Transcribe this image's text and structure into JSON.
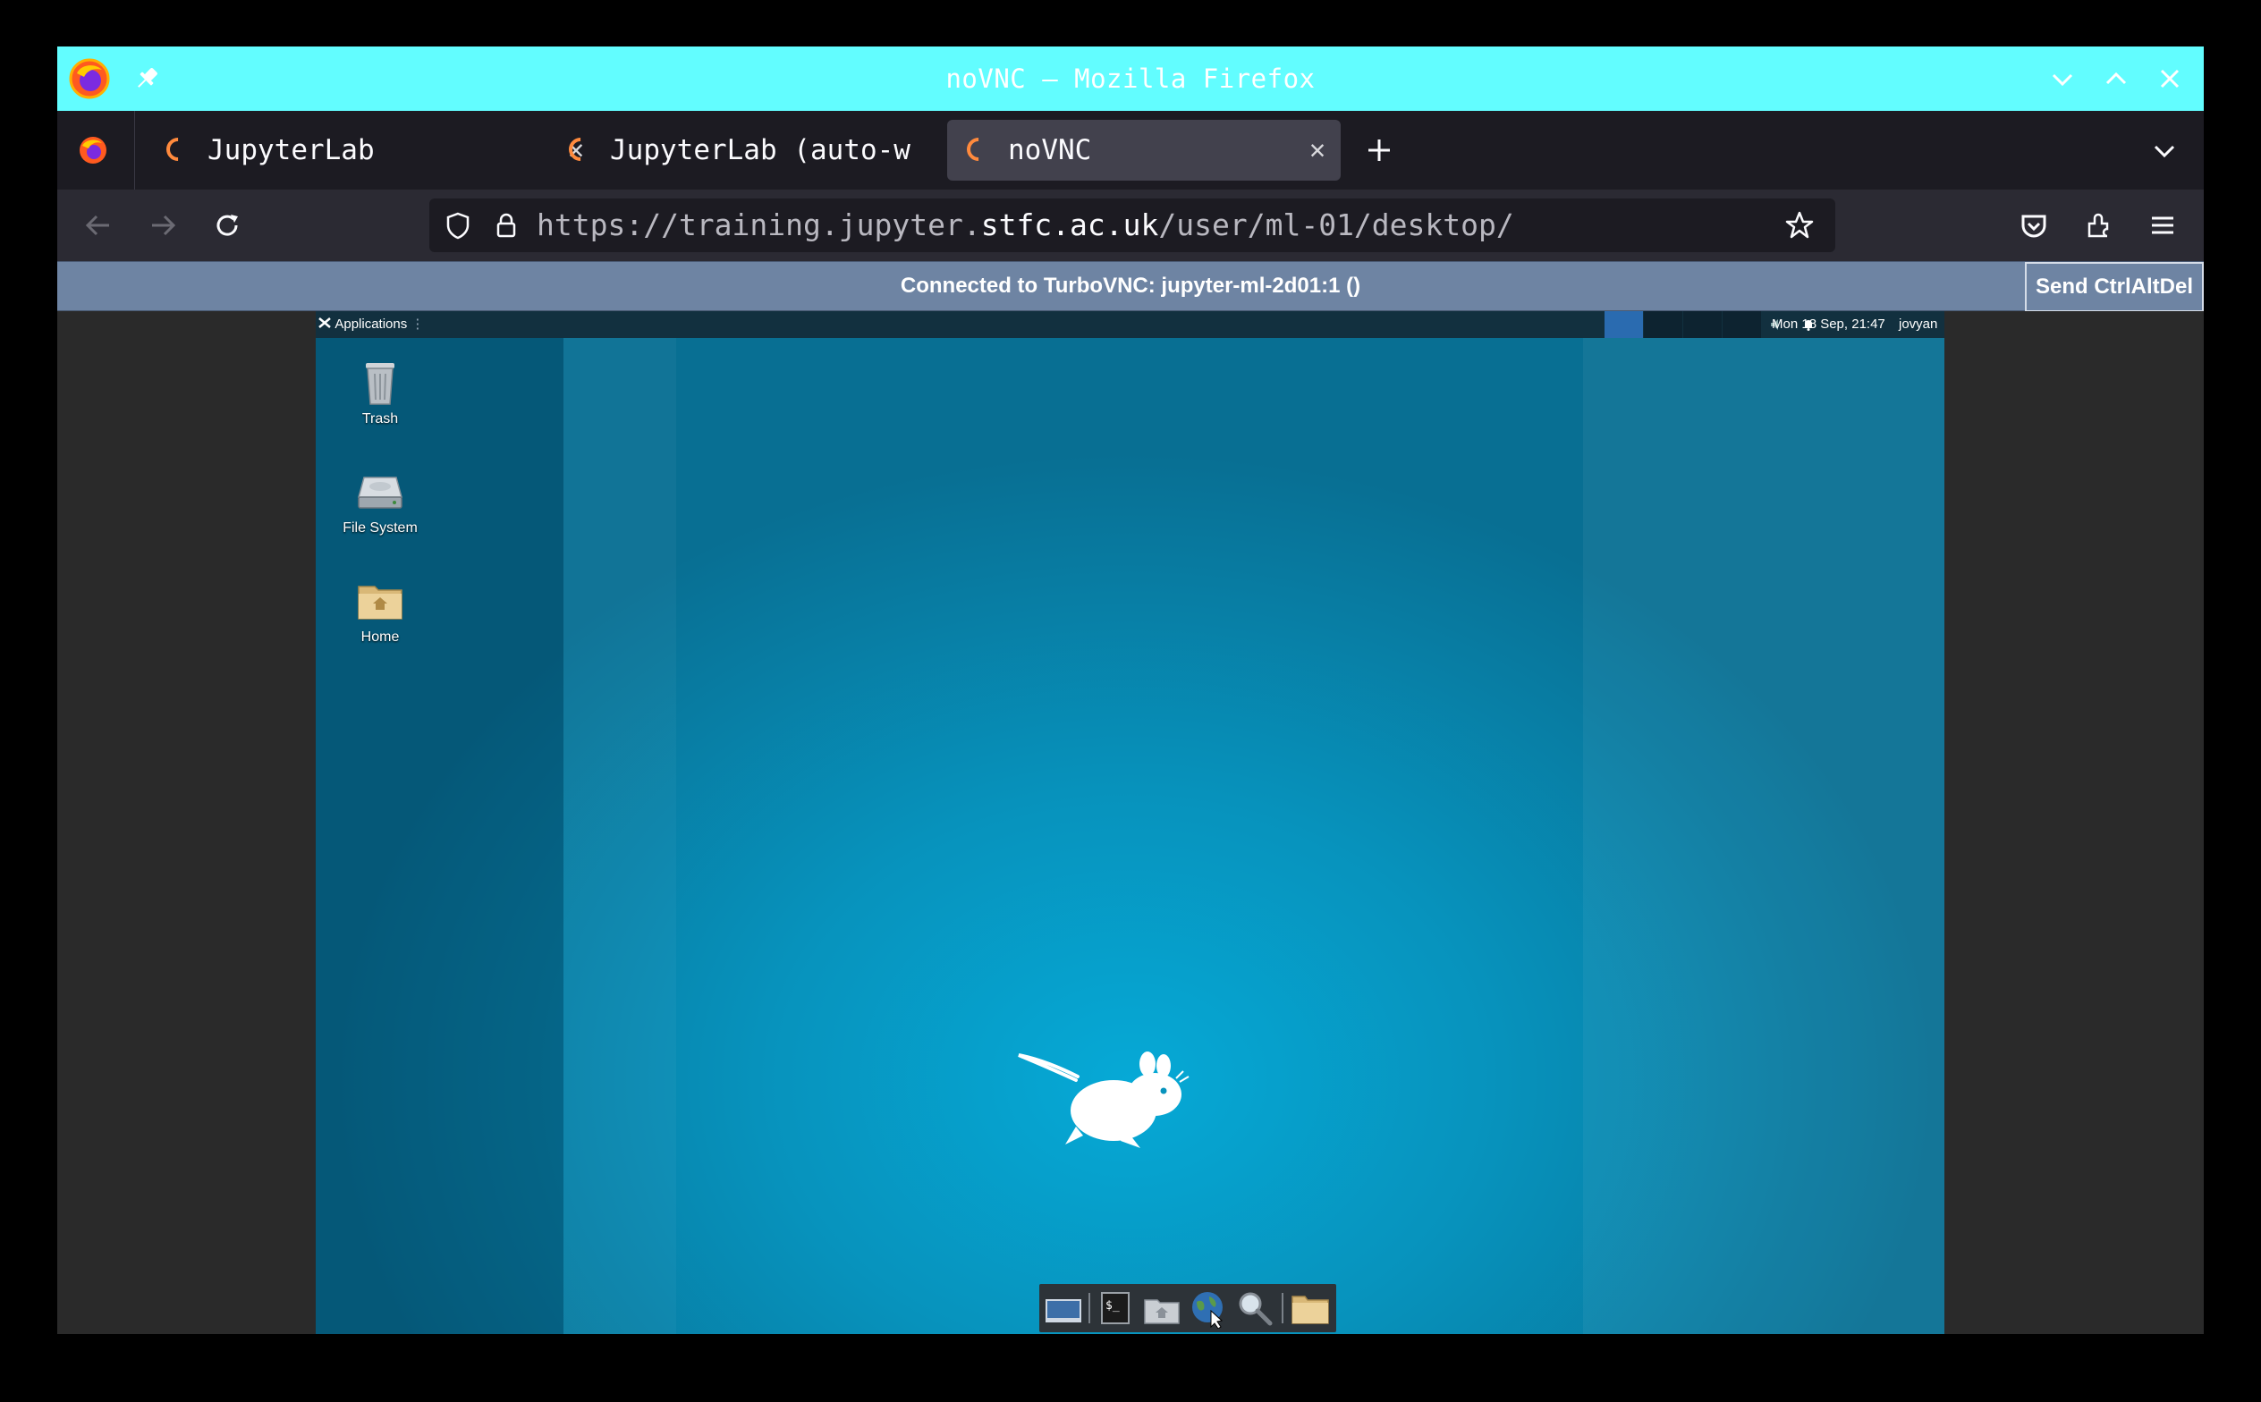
{
  "window": {
    "title": "noVNC — Mozilla Firefox"
  },
  "tabs": [
    {
      "label": "JupyterLab",
      "active": false
    },
    {
      "label": "JupyterLab (auto-w",
      "active": false
    },
    {
      "label": "noVNC",
      "active": true
    }
  ],
  "urlbar": {
    "url_prefix": "https://training.jupyter.",
    "url_domain": "stfc.ac.uk",
    "url_suffix": "/user/ml-01/desktop/"
  },
  "novnc": {
    "status": "Connected to TurboVNC: jupyter-ml-2d01:1 ()",
    "send_ctrl_alt_del": "Send CtrlAltDel"
  },
  "desktop": {
    "panel": {
      "applications_label": "Applications",
      "clock": "Mon 18 Sep, 21:47",
      "user": "jovyan"
    },
    "icons": [
      {
        "label": "Trash",
        "icon": "trash-icon"
      },
      {
        "label": "File System",
        "icon": "drive-icon"
      },
      {
        "label": "Home",
        "icon": "home-folder-icon"
      }
    ],
    "dock": [
      "show-desktop-icon",
      "terminal-icon",
      "file-manager-icon",
      "web-browser-icon",
      "app-finder-icon",
      "folder-icon"
    ]
  },
  "colors": {
    "titlebar": "#62fdff",
    "novnc_bar": "#6e84a3",
    "desktop": "#0793bd"
  }
}
